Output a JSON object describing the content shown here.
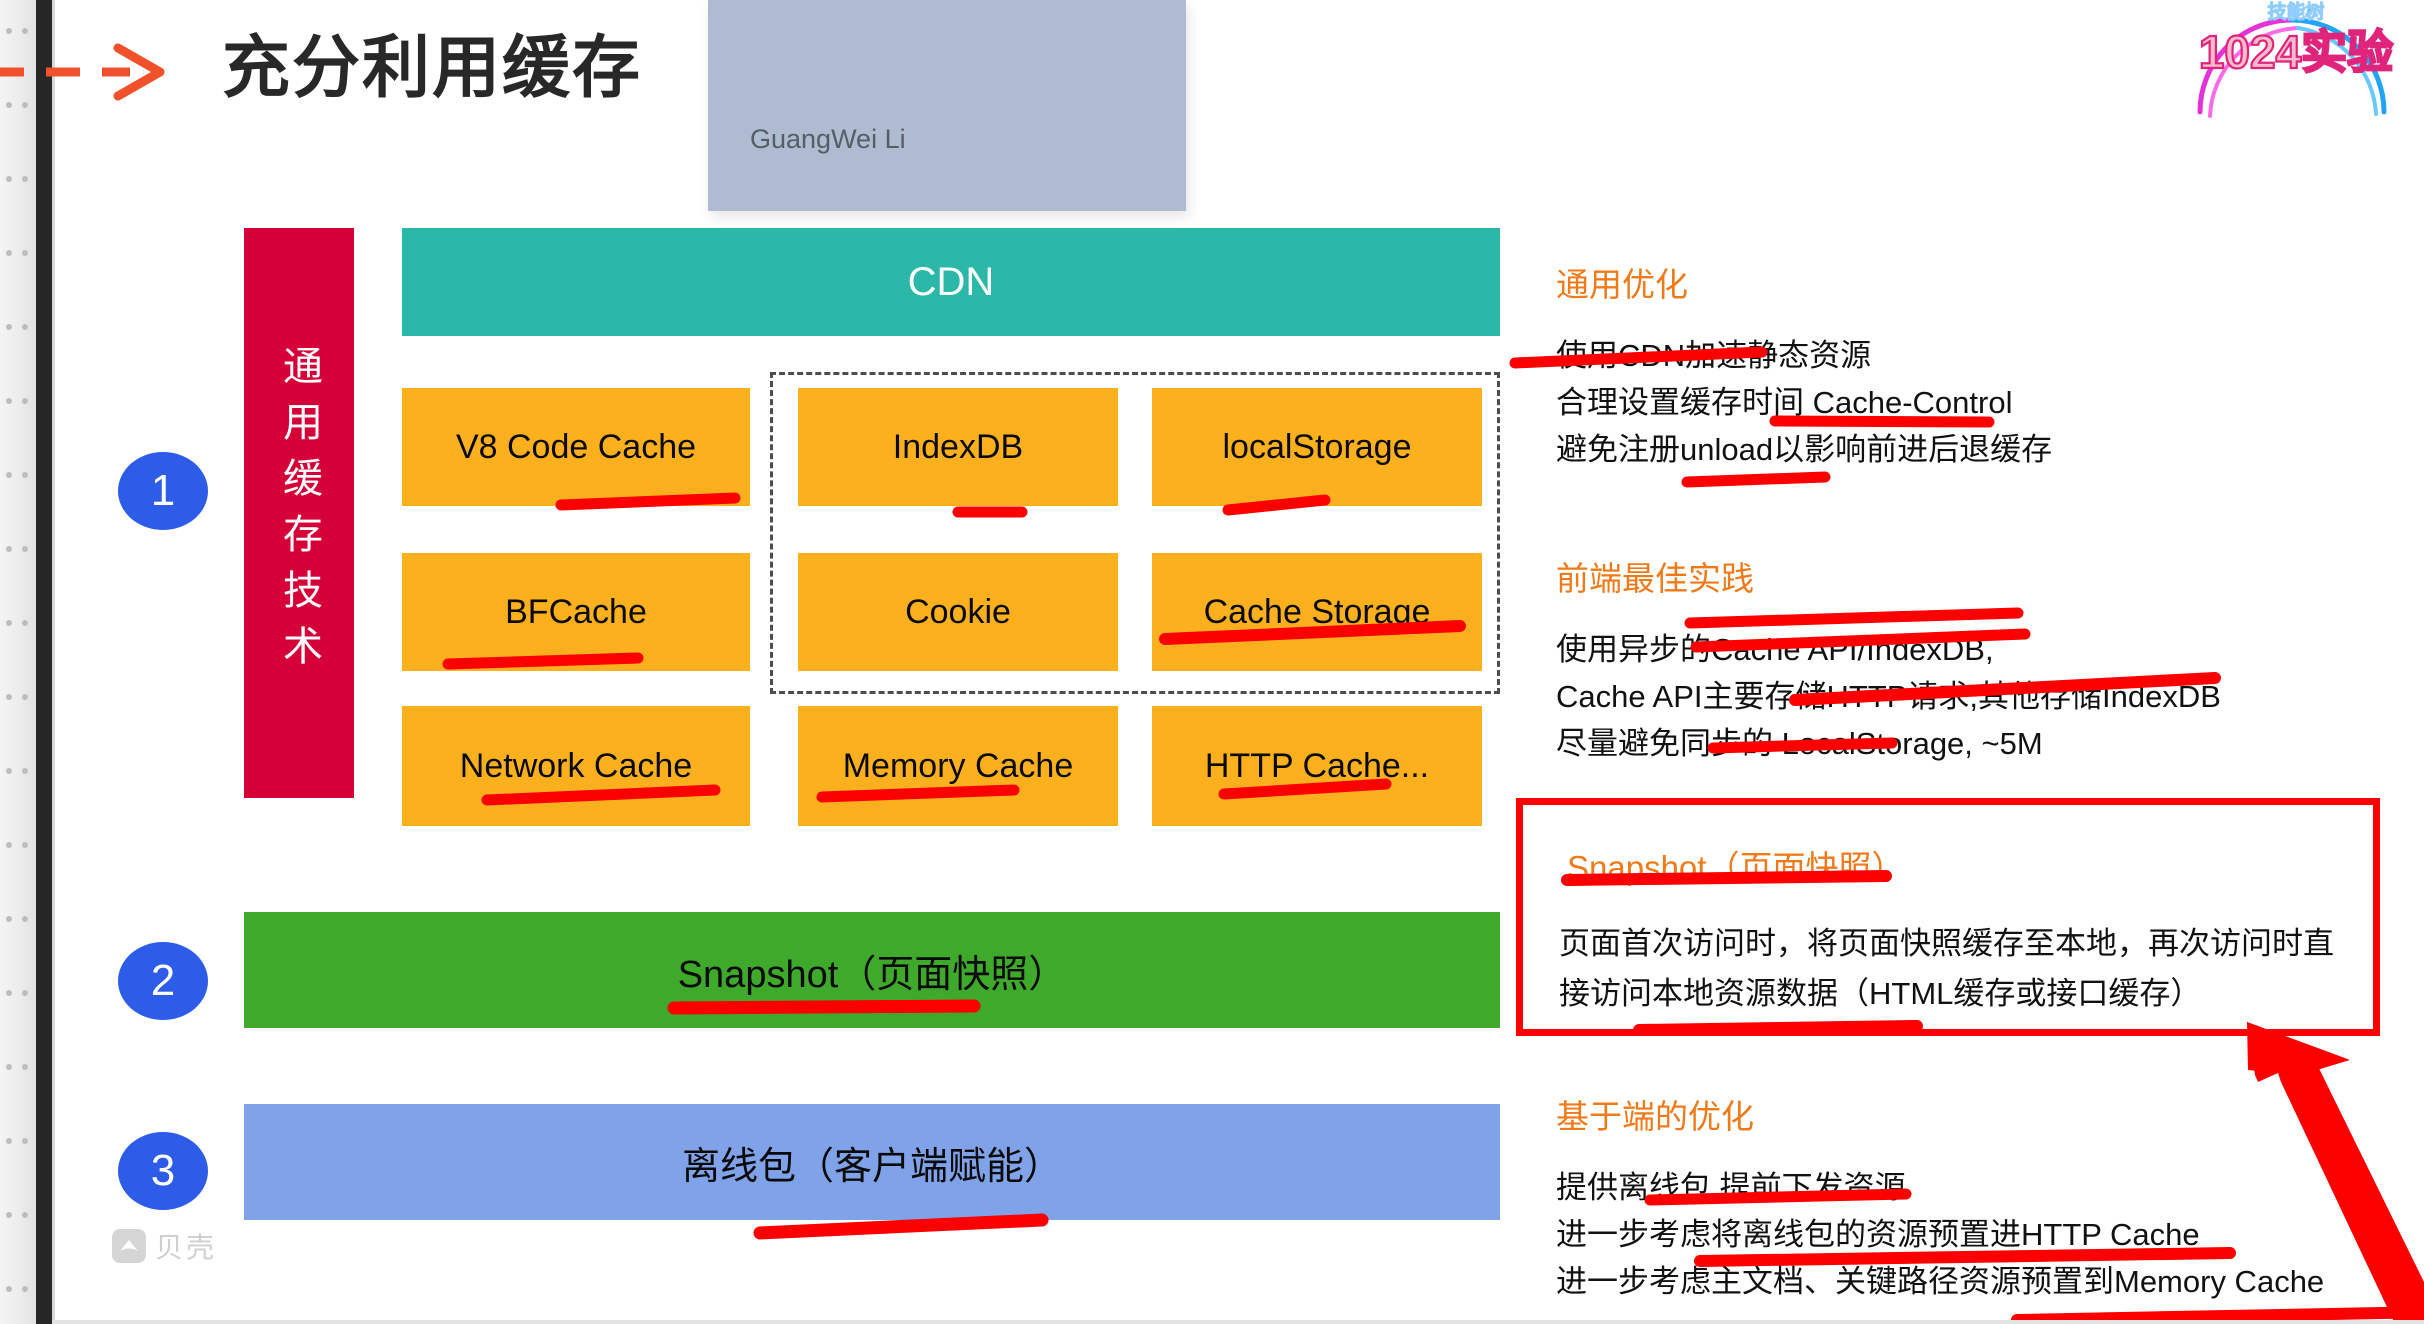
{
  "slide": {
    "title": "充分利用缓存",
    "author": "GuangWei Li",
    "watermark": "贝壳",
    "logo": {
      "top_text": "技能树",
      "main_text": "1024实验"
    }
  },
  "diagram": {
    "vertical_label": "通用缓存技术",
    "cdn_label": "CDN",
    "steps": [
      "1",
      "2",
      "3"
    ],
    "cache_boxes": [
      {
        "label": "V8 Code Cache",
        "col": 0,
        "row": 0,
        "marked": true
      },
      {
        "label": "IndexDB",
        "col": 1,
        "row": 0,
        "marked": true
      },
      {
        "label": "localStorage",
        "col": 2,
        "row": 0,
        "marked": true
      },
      {
        "label": "BFCache",
        "col": 0,
        "row": 1,
        "marked": true
      },
      {
        "label": "Cookie",
        "col": 1,
        "row": 1,
        "marked": false
      },
      {
        "label": "Cache Storage",
        "col": 2,
        "row": 1,
        "marked": true
      },
      {
        "label": "Network Cache",
        "col": 0,
        "row": 2,
        "marked": true
      },
      {
        "label": "Memory Cache",
        "col": 1,
        "row": 2,
        "marked": true
      },
      {
        "label": "HTTP Cache...",
        "col": 2,
        "row": 2,
        "marked": true
      }
    ],
    "snapshot_bar": "Snapshot（页面快照）",
    "offline_bar": "离线包（客户端赋能）"
  },
  "notes": {
    "general": {
      "heading": "通用优化",
      "lines": [
        "使用CDN加速静态资源",
        "合理设置缓存时间 Cache-Control",
        "避免注册unload以影响前进后退缓存"
      ]
    },
    "best_practice": {
      "heading": "前端最佳实践",
      "lines": [
        "使用异步的Cache API/IndexDB,",
        "Cache API主要存储HTTP请求,其他存储IndexDB",
        "尽量避免同步的 LocalStorage, ~5M"
      ]
    },
    "snapshot": {
      "heading": "Snapshot（页面快照）",
      "body": "页面首次访问时，将页面快照缓存至本地，再次访问时直接访问本地资源数据（HTML缓存或接口缓存）"
    },
    "client": {
      "heading": "基于端的优化",
      "lines": [
        "提供离线包,提前下发资源",
        "进一步考虑将离线包的资源预置进HTTP Cache",
        "进一步考虑主文档、关键路径资源预置到Memory Cache"
      ]
    }
  },
  "colors": {
    "crimson": "#D50037",
    "teal": "#2CB8A8",
    "orange": "#FCB01E",
    "green": "#3FA92C",
    "blue_bar": "#7FA2E8",
    "circle_blue": "#2D5DE8",
    "marker_red": "#FC0000",
    "heading_orange": "#F07A1A",
    "author_plate": "#AEBBD0"
  }
}
